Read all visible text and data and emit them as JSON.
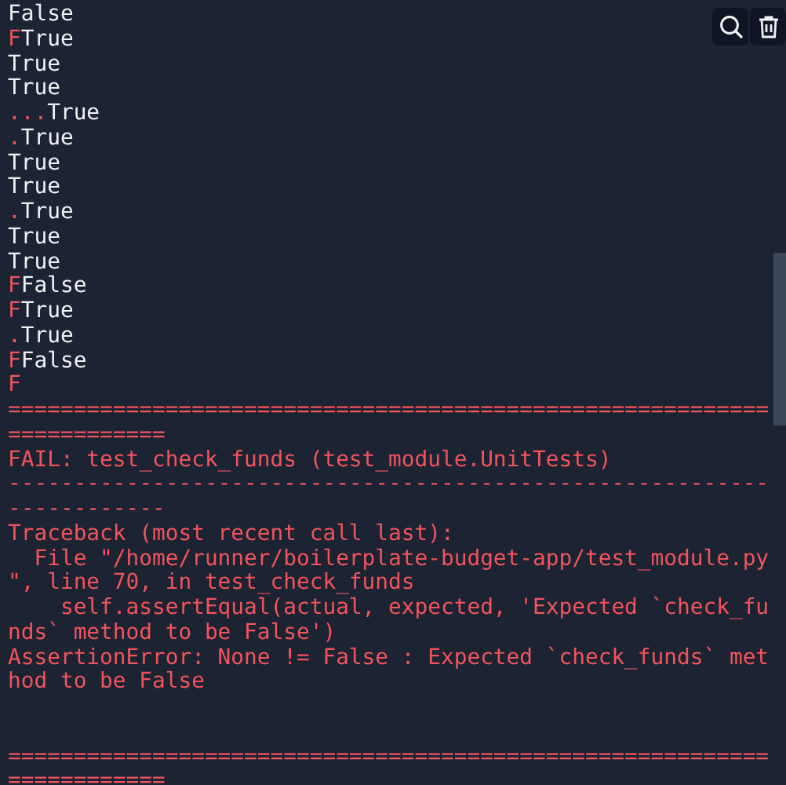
{
  "console": {
    "lines": [
      {
        "spans": [
          {
            "text": "False",
            "kind": "output"
          }
        ]
      },
      {
        "spans": [
          {
            "text": "F",
            "kind": "error"
          },
          {
            "text": "True",
            "kind": "output"
          }
        ]
      },
      {
        "spans": [
          {
            "text": "True",
            "kind": "output"
          }
        ]
      },
      {
        "spans": [
          {
            "text": "True",
            "kind": "output"
          }
        ]
      },
      {
        "spans": [
          {
            "text": "...",
            "kind": "error"
          },
          {
            "text": "True",
            "kind": "output"
          }
        ]
      },
      {
        "spans": [
          {
            "text": ".",
            "kind": "error"
          },
          {
            "text": "True",
            "kind": "output"
          }
        ]
      },
      {
        "spans": [
          {
            "text": "True",
            "kind": "output"
          }
        ]
      },
      {
        "spans": [
          {
            "text": "True",
            "kind": "output"
          }
        ]
      },
      {
        "spans": [
          {
            "text": ".",
            "kind": "error"
          },
          {
            "text": "True",
            "kind": "output"
          }
        ]
      },
      {
        "spans": [
          {
            "text": "True",
            "kind": "output"
          }
        ]
      },
      {
        "spans": [
          {
            "text": "True",
            "kind": "output"
          }
        ]
      },
      {
        "spans": [
          {
            "text": "F",
            "kind": "error"
          },
          {
            "text": "False",
            "kind": "output"
          }
        ]
      },
      {
        "spans": [
          {
            "text": "F",
            "kind": "error"
          },
          {
            "text": "True",
            "kind": "output"
          }
        ]
      },
      {
        "spans": [
          {
            "text": ".",
            "kind": "error"
          },
          {
            "text": "True",
            "kind": "output"
          }
        ]
      },
      {
        "spans": [
          {
            "text": "F",
            "kind": "error"
          },
          {
            "text": "False",
            "kind": "output"
          }
        ]
      },
      {
        "spans": [
          {
            "text": "F",
            "kind": "error"
          }
        ]
      },
      {
        "spans": [
          {
            "text": "==========================================================",
            "kind": "error"
          }
        ]
      },
      {
        "spans": [
          {
            "text": "============",
            "kind": "error"
          }
        ]
      },
      {
        "spans": [
          {
            "text": "FAIL: test_check_funds (test_module.UnitTests)",
            "kind": "error"
          }
        ]
      },
      {
        "spans": [
          {
            "text": "----------------------------------------------------------",
            "kind": "error"
          }
        ]
      },
      {
        "spans": [
          {
            "text": "------------",
            "kind": "error"
          }
        ]
      },
      {
        "spans": [
          {
            "text": "Traceback (most recent call last):",
            "kind": "error"
          }
        ]
      },
      {
        "spans": [
          {
            "text": "  File \"/home/runner/boilerplate-budget-app/test_module.py",
            "kind": "error"
          }
        ]
      },
      {
        "spans": [
          {
            "text": "\", line 70, in test_check_funds",
            "kind": "error"
          }
        ]
      },
      {
        "spans": [
          {
            "text": "    self.assertEqual(actual, expected, 'Expected `check_fu",
            "kind": "error"
          }
        ]
      },
      {
        "spans": [
          {
            "text": "nds` method to be False')",
            "kind": "error"
          }
        ]
      },
      {
        "spans": [
          {
            "text": "AssertionError: None != False : Expected `check_funds` met",
            "kind": "error"
          }
        ]
      },
      {
        "spans": [
          {
            "text": "hod to be False",
            "kind": "error"
          }
        ]
      },
      {
        "gap_before": true,
        "spans": [
          {
            "text": "==========================================================",
            "kind": "error"
          }
        ]
      },
      {
        "spans": [
          {
            "text": "============",
            "kind": "error"
          }
        ]
      }
    ]
  }
}
